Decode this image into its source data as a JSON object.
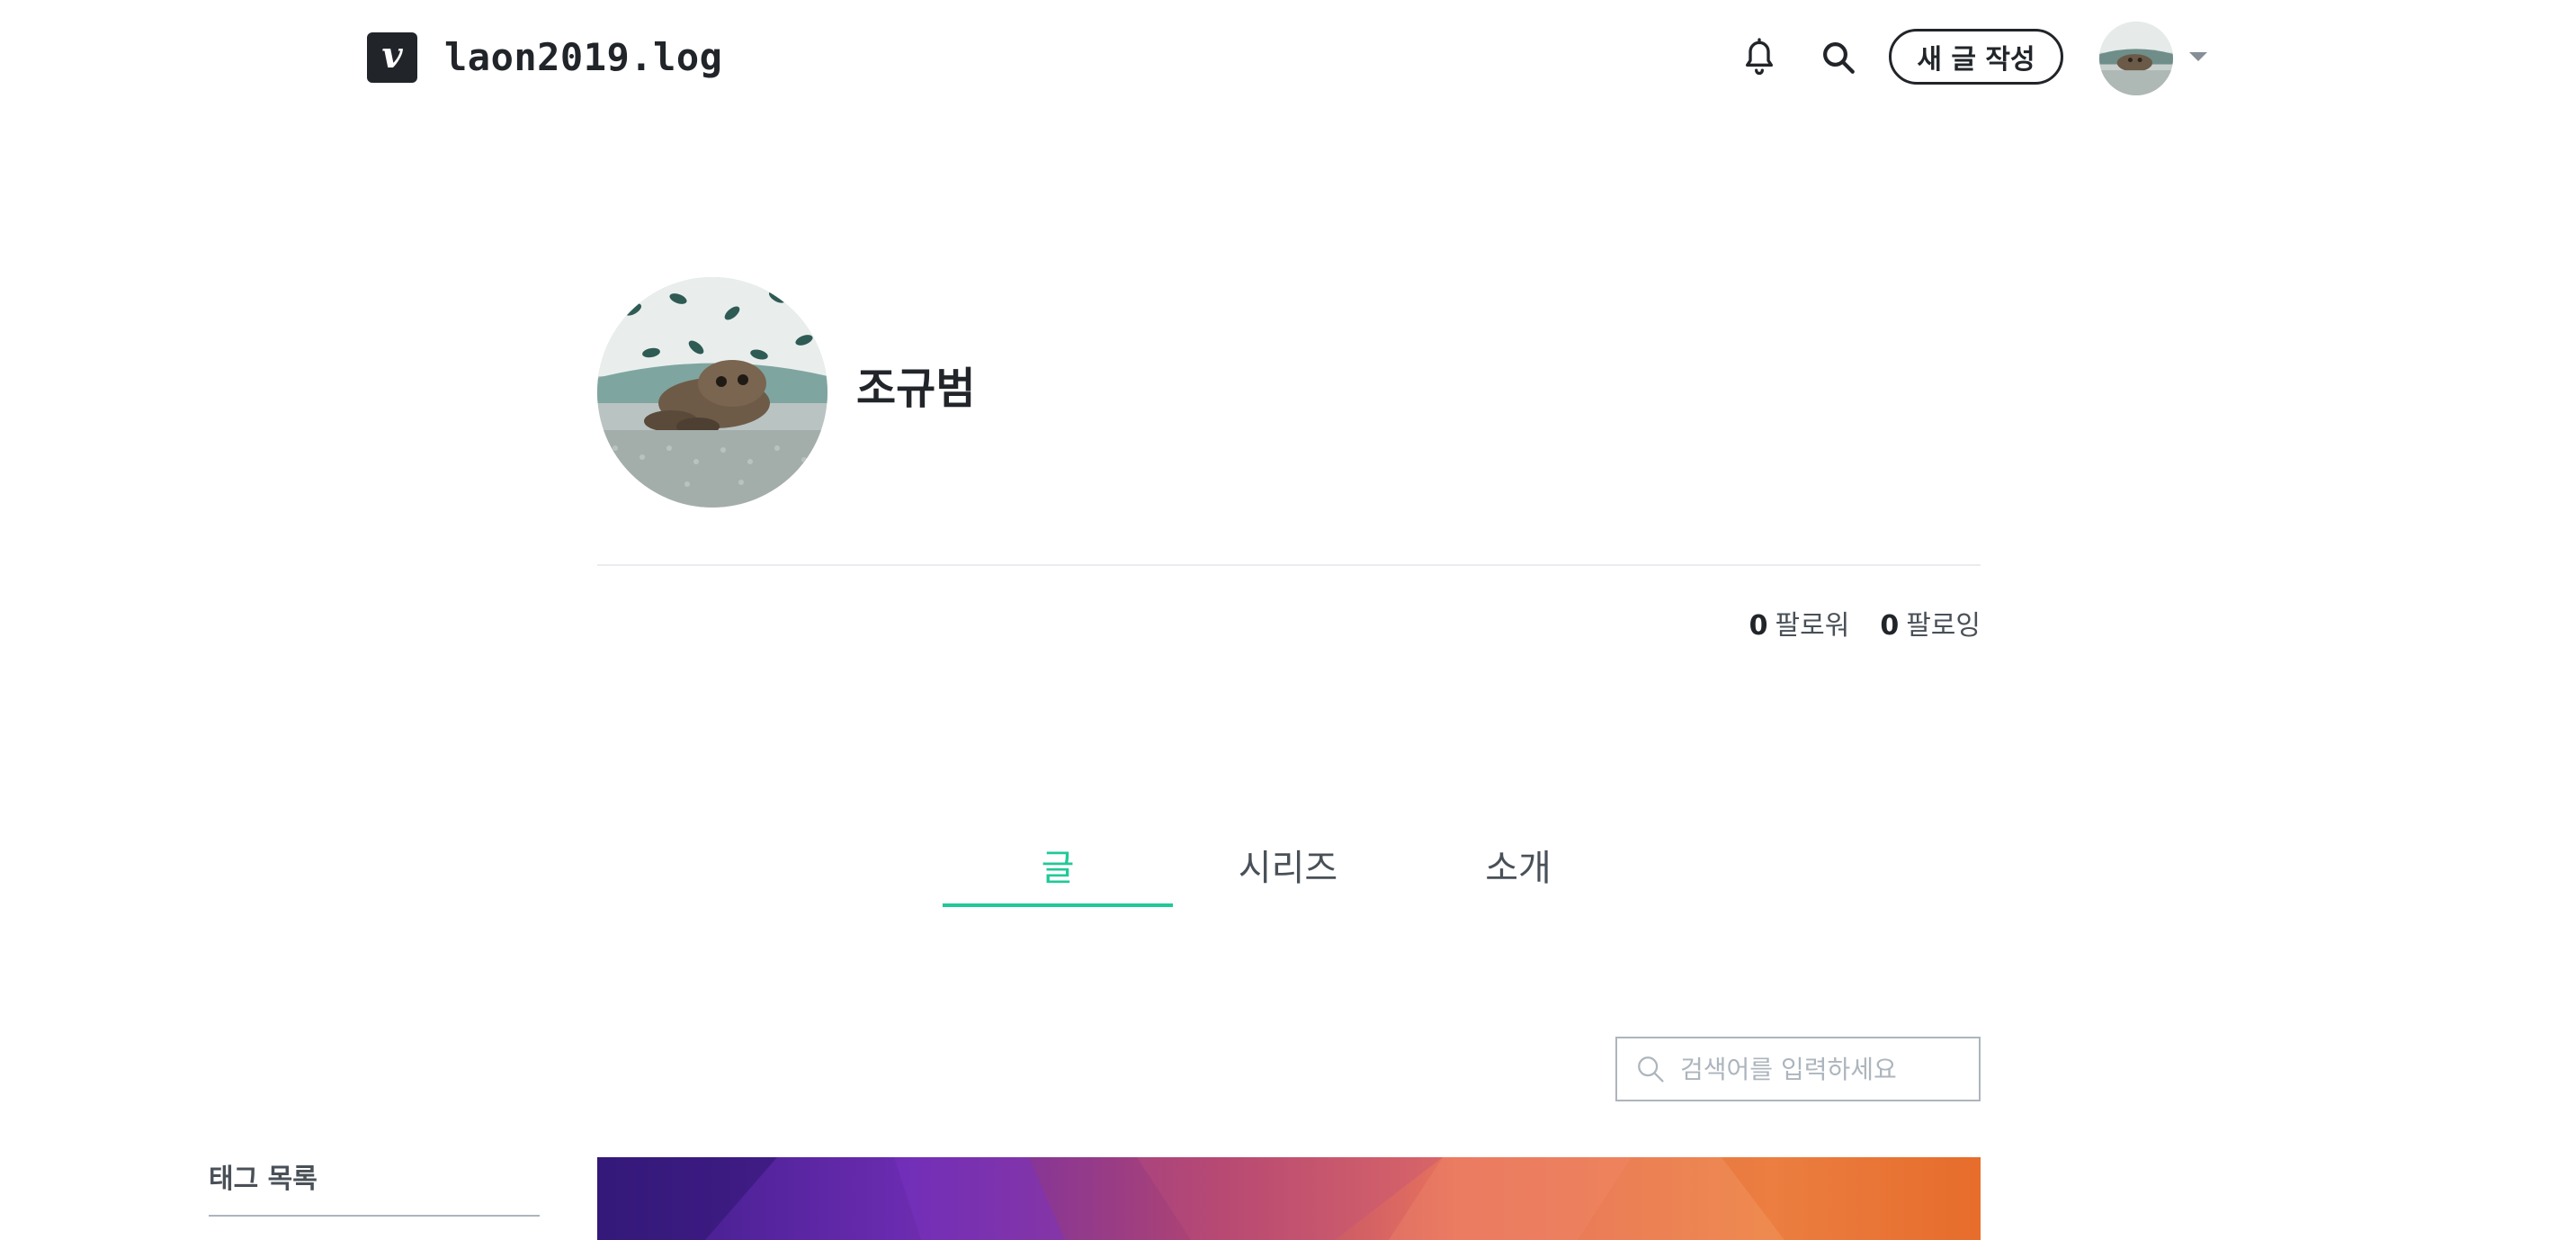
{
  "header": {
    "logo_letter": "v",
    "blog_title": "laon2019.log",
    "write_button": "새 글 작성",
    "icons": [
      "bell-icon",
      "search-icon",
      "caret-down-icon"
    ]
  },
  "profile": {
    "name": "조규범",
    "followers_count": "0",
    "followers_label": "팔로워",
    "following_count": "0",
    "following_label": "팔로잉"
  },
  "tabs": [
    {
      "label": "글",
      "active": true
    },
    {
      "label": "시리즈",
      "active": false
    },
    {
      "label": "소개",
      "active": false
    }
  ],
  "search": {
    "placeholder": "검색어를 입력하세요"
  },
  "sidebar": {
    "tag_title": "태그 목록"
  },
  "colors": {
    "accent": "#20c997",
    "text": "#212529",
    "muted": "#495057",
    "border": "#adb5bd"
  }
}
